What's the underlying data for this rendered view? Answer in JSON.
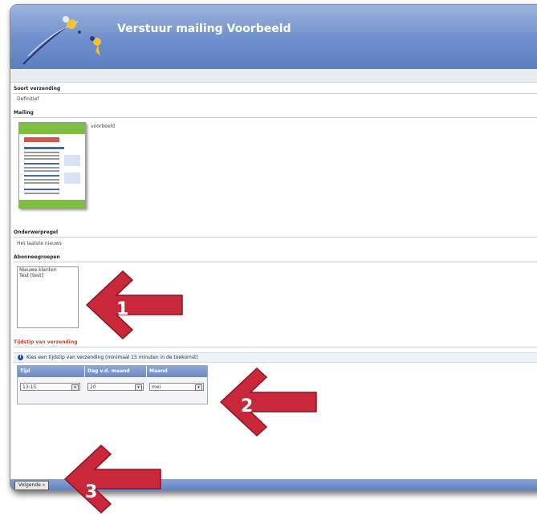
{
  "header": {
    "title": "Verstuur mailing Voorbeeld"
  },
  "sections": {
    "soort_verzending": {
      "label": "Soort verzending",
      "value": "Definitief"
    },
    "mailing": {
      "label": "Mailing",
      "name": "voorbeeld"
    },
    "onderwerpregel": {
      "label": "Onderwerpregel",
      "value": "Het laatste nieuws"
    },
    "abonneegroepen": {
      "label": "Abonneegroepen",
      "items": [
        "Nieuwe klanten",
        "Test [test]"
      ]
    },
    "tijdstip": {
      "label": "Tijdstip van verzending",
      "info": "Kies een tijdstip van verzending (minimaal 15 minuten in de toekomst)",
      "columns": [
        "Tijd",
        "Dag v.d. maand",
        "Maand"
      ],
      "values": [
        "13:15",
        "20",
        "mei"
      ]
    }
  },
  "footer": {
    "next_label": "Volgende »"
  },
  "callouts": [
    "1",
    "2",
    "3"
  ],
  "colors": {
    "header_blue": "#6e8fcb",
    "callout_red": "#c8283a",
    "section_red": "#d43a2a"
  }
}
